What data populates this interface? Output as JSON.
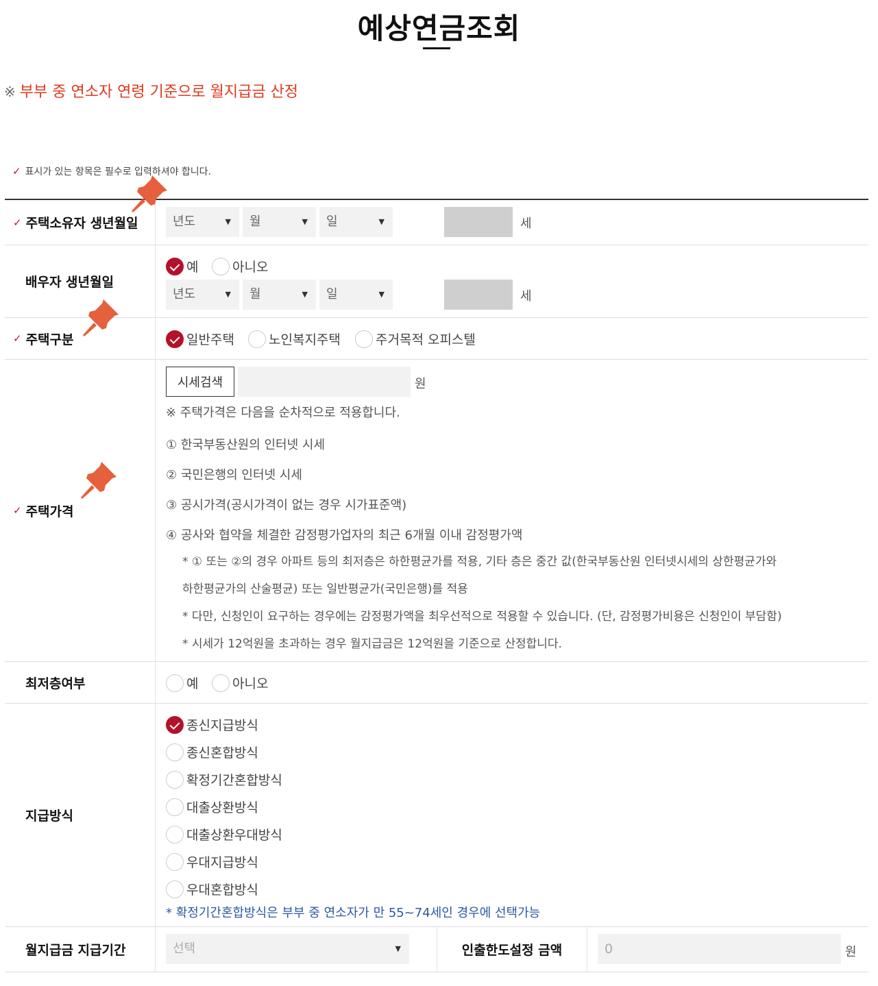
{
  "page": {
    "title": "예상연금조회",
    "notice_mark": "※",
    "notice_text": "부부 중 연소자 연령 기준으로 월지급금 산정",
    "required_note": "표시가 있는 항목은 필수로 입력하셔야 합니다.",
    "required_check_icon": "check-icon"
  },
  "owner_birth": {
    "label": "주택소유자 생년월일",
    "year_placeholder": "년도",
    "month_placeholder": "월",
    "day_placeholder": "일",
    "age_unit": "세"
  },
  "spouse_birth": {
    "label": "배우자 생년월일",
    "options": [
      "예",
      "아니오"
    ],
    "selected": "예",
    "year_placeholder": "년도",
    "month_placeholder": "월",
    "day_placeholder": "일",
    "age_unit": "세"
  },
  "house_type": {
    "label": "주택구분",
    "options": [
      "일반주택",
      "노인복지주택",
      "주거목적 오피스텔"
    ],
    "selected": "일반주택"
  },
  "house_price": {
    "label": "주택가격",
    "search_button": "시세검색",
    "unit": "원",
    "note_header": "※ 주택가격은 다음을 순차적으로 적용합니다.",
    "items": [
      "① 한국부동산원의 인터넷 시세",
      "② 국민은행의 인터넷 시세",
      "③ 공시가격(공시가격이 없는 경우 시가표준액)",
      "④ 공사와 협약을 체결한 감정평가업자의 최근 6개월 이내 감정평가액"
    ],
    "sub_notes": [
      "* ① 또는 ②의 경우 아파트 등의 최저층은 하한평균가를 적용, 기타 층은 중간 값(한국부동산원 인터넷시세의 상한평균가와",
      "하한평균가의 산술평균) 또는 일반평균가(국민은행)를 적용",
      "* 다만, 신청인이 요구하는 경우에는 감정평가액을 최우선적으로 적용할 수 있습니다. (단, 감정평가비용은 신청인이 부담함)",
      "* 시세가 12억원을 초과하는 경우 월지급금은 12억원을 기준으로 산정합니다."
    ]
  },
  "lowest_floor": {
    "label": "최저층여부",
    "options": [
      "예",
      "아니오"
    ]
  },
  "payment_method": {
    "label": "지급방식",
    "options": [
      "종신지급방식",
      "종신혼합방식",
      "확정기간혼합방식",
      "대출상환방식",
      "대출상환우대방식",
      "우대지급방식",
      "우대혼합방식"
    ],
    "selected": "종신지급방식",
    "note": "* 확정기간혼합방식은 부부 중 연소자가 만 55~74세인 경우에 선택가능"
  },
  "payment_period": {
    "label": "월지급금 지급기간",
    "select_placeholder": "선택",
    "limit_label": "인출한도설정 금액",
    "limit_value": "0",
    "limit_unit": "원"
  },
  "colors": {
    "accent_red": "#b3122a",
    "notice_red": "#e0381c",
    "note_blue": "#2a57a8",
    "pin_orange": "#e5603c"
  }
}
